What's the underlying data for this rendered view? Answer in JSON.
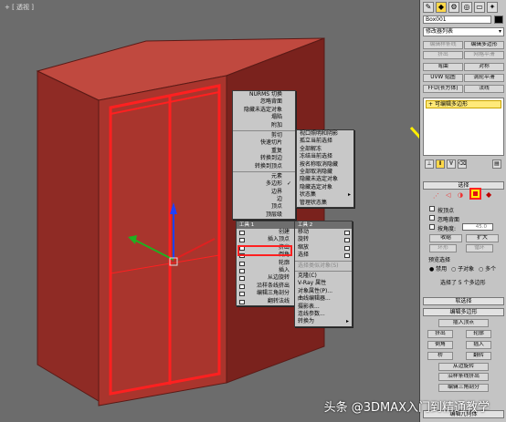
{
  "viewport": {
    "label": "+ [ 透视 ]"
  },
  "quad_menu": {
    "top_left": [
      "NURMS 切换",
      "忽略背面",
      "隐藏未选定对象",
      "塌陷",
      "附加",
      "剪切",
      "快速切片",
      "重复",
      "转换到边",
      "转换到顶点",
      "元素",
      "多边形",
      "边界",
      "边",
      "顶点",
      "顶层级"
    ],
    "top_left_checked": "多边形",
    "top_right": [
      "视口照明和阴影",
      "孤立当前选择",
      "全部解冻",
      "冻结当前选择",
      "按名称取消隐藏",
      "全部取消隐藏",
      "隐藏未选定对象",
      "隐藏选定对象",
      "状态集",
      "管理状态集"
    ],
    "header_left": "工具 1",
    "header_right": "工具 2",
    "bottom_left": [
      "创建",
      "插入顶点",
      "挤出",
      "倒角",
      "轮廓",
      "插入",
      "从边旋转",
      "沿样条线挤出",
      "编辑三角剖分",
      "翻转法线"
    ],
    "bottom_left_highlight": "挤出",
    "bottom_right": [
      "移动",
      "旋转",
      "缩放",
      "选择",
      "选择类似对象(S)",
      "克隆(C)",
      "V-Ray 属性",
      "对象属性(P)...",
      "曲线编辑器...",
      "摄影表...",
      "连线参数...",
      "转换为"
    ]
  },
  "panel": {
    "object_name": "Box001",
    "modifier_list_label": "修改器列表",
    "buttons_row1": [
      "编辑样条线",
      "编辑多边形"
    ],
    "buttons_row2": [
      "挤出",
      "网格平滑"
    ],
    "buttons_row3": [
      "弯曲",
      "对称"
    ],
    "buttons_row4": [
      "UVW 贴图",
      "涡轮平滑"
    ],
    "buttons_row5": [
      "FFD(长方体)",
      "法线"
    ],
    "stack_item": "可编辑多边形",
    "selection_rollout": "选择",
    "by_vertex": "按顶点",
    "ignore_backfacing": "忽略背面",
    "by_angle": "按角度:",
    "by_angle_value": "45.0",
    "shrink": "收缩",
    "grow": "扩大",
    "ring": "环形",
    "loop": "循环",
    "preview_label": "预览选择",
    "preview_disabled": "禁用",
    "preview_subobj": "子对象",
    "preview_multi": "多个",
    "selected_text": "选择了 5 个多边形",
    "soft_selection": "软选择",
    "edit_polygons": "编辑多边形",
    "insert_vertex": "插入顶点",
    "ops": [
      [
        "挤出",
        "轮廓"
      ],
      [
        "倒角",
        "插入"
      ],
      [
        "桥",
        "翻转"
      ]
    ],
    "hinge": "从边旋转",
    "extrude_spline": "沿样条线挤出",
    "edit_tri": "编辑三角剖分",
    "edit_geometry": "编辑几何体"
  },
  "watermark": "头条 @3DMAX入门到精通教学",
  "colors": {
    "object": "#b03a33",
    "highlight": "#ff2020",
    "callout": "#ffee00"
  }
}
